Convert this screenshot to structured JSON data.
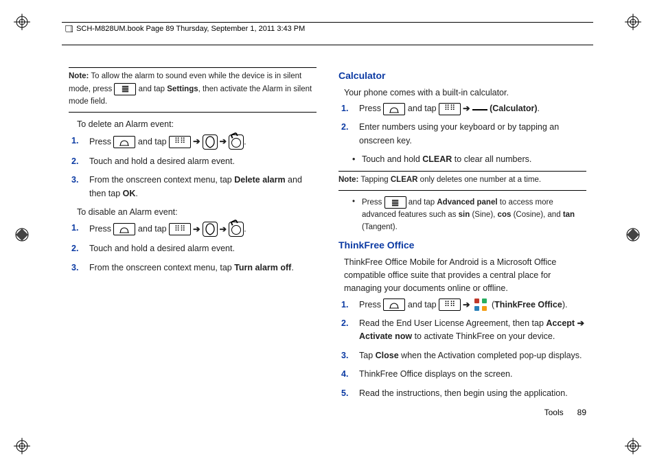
{
  "header": {
    "crop_label": "SCH-M828UM.book  Page 89  Thursday, September 1, 2011  3:43 PM"
  },
  "left": {
    "note1_label": "Note:",
    "note1_text_a": " To allow the alarm to sound even while the device is in silent mode, press ",
    "note1_text_b": " and tap ",
    "note1_settings": "Settings",
    "note1_text_c": ", then activate the Alarm in silent mode field.",
    "del_lead": "To delete an Alarm event:",
    "del_s1_a": "Press ",
    "del_s1_b": " and tap ",
    "del_s1_c": ".",
    "del_s2": "Touch and hold a desired alarm event.",
    "del_s3_a": "From the onscreen context menu, tap ",
    "del_s3_b": "Delete alarm",
    "del_s3_c": " and then tap ",
    "del_s3_d": "OK",
    "del_s3_e": ".",
    "dis_lead": "To disable an Alarm event:",
    "dis_s1_a": "Press ",
    "dis_s1_b": " and tap ",
    "dis_s1_c": ".",
    "dis_s2": "Touch and hold a desired alarm event.",
    "dis_s3_a": "From the onscreen context menu, tap ",
    "dis_s3_b": "Turn alarm off",
    "dis_s3_c": "."
  },
  "right": {
    "calc_heading": "Calculator",
    "calc_lead": "Your phone comes with a built-in calculator.",
    "calc_s1_a": "Press ",
    "calc_s1_b": " and tap ",
    "calc_s1_label": "(Calculator)",
    "calc_s1_c": ".",
    "calc_s2": "Enter numbers using your keyboard or by tapping an onscreen key.",
    "calc_b1_a": "Touch and hold ",
    "calc_b1_b": "CLEAR",
    "calc_b1_c": " to clear all numbers.",
    "calc_note_label": "Note:",
    "calc_note_a": " Tapping ",
    "calc_note_b": "CLEAR",
    "calc_note_c": " only deletes one number at a time.",
    "calc_b2_a": "Press ",
    "calc_b2_b": " and tap ",
    "calc_b2_c": "Advanced panel",
    "calc_b2_d": " to access more advanced features such as ",
    "calc_b2_sin": "sin",
    "calc_b2_sin_lbl": " (Sine), ",
    "calc_b2_cos": "cos",
    "calc_b2_cos_lbl": " (Cosine), and ",
    "calc_b2_tan": "tan",
    "calc_b2_tan_lbl": " (Tangent).",
    "tf_heading": "ThinkFree Office",
    "tf_lead": "ThinkFree Office Mobile for Android is a Microsoft Office compatible office suite that provides a central place for managing your documents online or offline.",
    "tf_s1_a": "Press ",
    "tf_s1_b": " and tap ",
    "tf_s1_label": "(ThinkFree Office)",
    "tf_s1_c": ".",
    "tf_s2_a": "Read the End User License Agreement, then tap ",
    "tf_s2_b": "Accept",
    "tf_s2_arrow": " ➔ ",
    "tf_s2_c": "Activate now",
    "tf_s2_d": " to activate ThinkFree on your device.",
    "tf_s3_a": "Tap ",
    "tf_s3_b": "Close",
    "tf_s3_c": " when the Activation completed pop-up displays.",
    "tf_s4": "ThinkFree Office displays on the screen.",
    "tf_s5": "Read the instructions, then begin using the application."
  },
  "footer": {
    "section": "Tools",
    "page": "89"
  }
}
